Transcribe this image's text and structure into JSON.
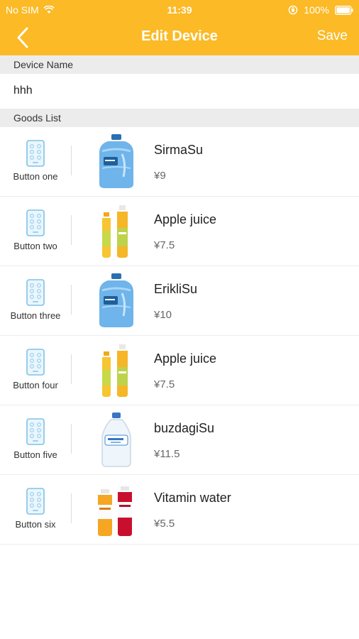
{
  "status": {
    "carrier": "No SIM",
    "time": "11:39",
    "battery": "100%"
  },
  "nav": {
    "title": "Edit Device",
    "save_label": "Save"
  },
  "device_name": {
    "label": "Device Name",
    "value": "hhh"
  },
  "goods": {
    "label": "Goods List",
    "items": [
      {
        "button": "Button one",
        "name": "SirmaSu",
        "price": "¥9",
        "image": "water-jug"
      },
      {
        "button": "Button two",
        "name": "Apple juice",
        "price": "¥7.5",
        "image": "juice-bottles"
      },
      {
        "button": "Button three",
        "name": "ErikliSu",
        "price": "¥10",
        "image": "water-jug"
      },
      {
        "button": "Button four",
        "name": "Apple juice",
        "price": "¥7.5",
        "image": "juice-bottles"
      },
      {
        "button": "Button five",
        "name": "buzdagiSu",
        "price": "¥11.5",
        "image": "clear-water-bottle"
      },
      {
        "button": "Button six",
        "name": "Vitamin water",
        "price": "¥5.5",
        "image": "vitamin-water-bottles"
      }
    ]
  },
  "colors": {
    "accent": "#FBBA26",
    "section_bg": "#ececec"
  }
}
